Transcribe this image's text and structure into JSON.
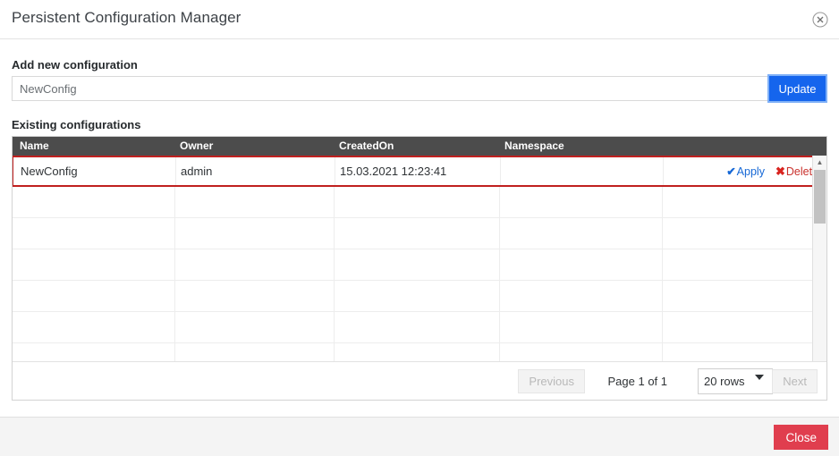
{
  "window": {
    "title": "Persistent Configuration Manager",
    "close_icon": "circle-x-icon"
  },
  "add_section": {
    "label": "Add new configuration",
    "input_value": "NewConfig",
    "input_placeholder": "NewConfig",
    "update_label": "Update"
  },
  "existing_section": {
    "label": "Existing configurations",
    "columns": [
      "Name",
      "Owner",
      "CreatedOn",
      "Namespace"
    ],
    "rows": [
      {
        "name": "NewConfig",
        "owner": "admin",
        "created_on": "15.03.2021 12:23:41",
        "namespace": "",
        "apply_label": "Apply",
        "delete_label": "Delete",
        "selected": true
      }
    ],
    "empty_row_count": 6,
    "selected_row_border_color": "#c0201f"
  },
  "scrollbar": {
    "up_arrow": "triangle-up-icon",
    "down_arrow": "triangle-down-icon"
  },
  "pagination": {
    "previous_label": "Previous",
    "next_label": "Next",
    "page_label": "Page 1 of 1",
    "rows_per_page": "20 rows",
    "rows_options": [
      "20 rows"
    ],
    "previous_disabled": true,
    "next_disabled": true
  },
  "footer": {
    "close_label": "Close"
  },
  "colors": {
    "primary_button": "#1565ed",
    "danger_button": "#e03e4e",
    "apply_link": "#1668d6",
    "delete_link": "#c9302c",
    "table_header": "#4c4c4c"
  }
}
